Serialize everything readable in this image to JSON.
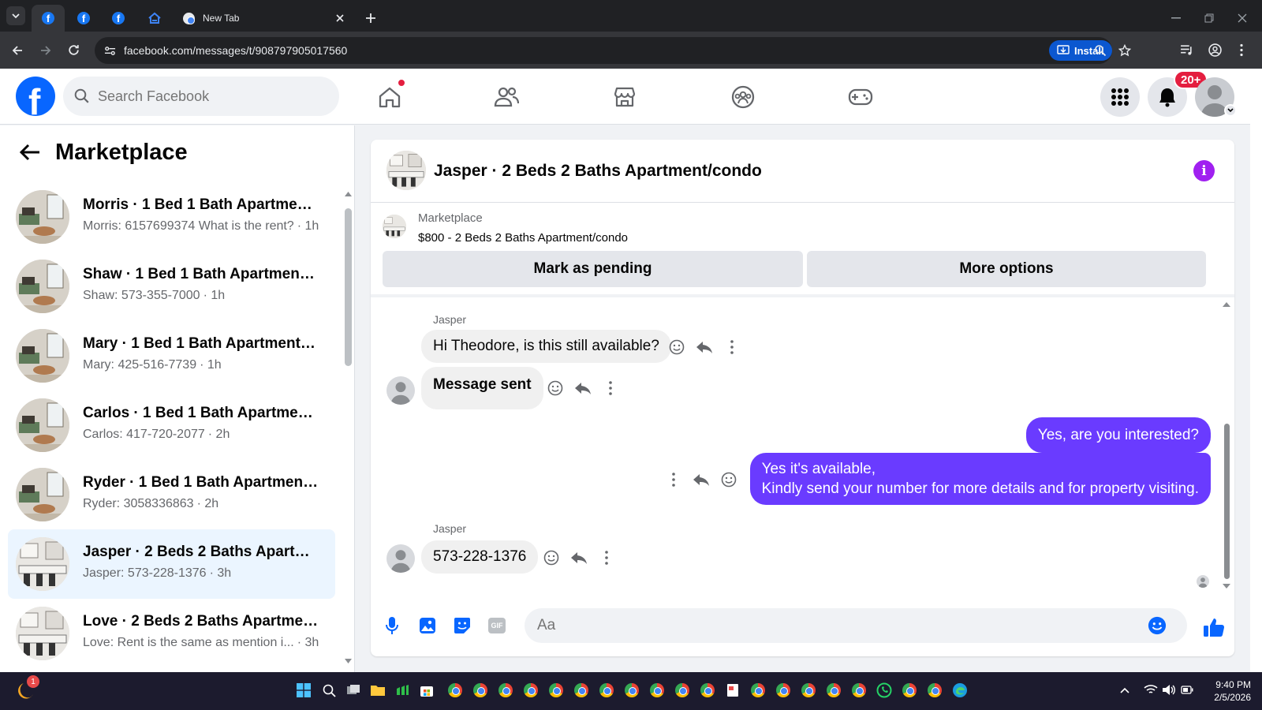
{
  "browser": {
    "tabs": [
      {
        "label": "",
        "icon": "facebook-icon"
      },
      {
        "label": "",
        "icon": "facebook-icon"
      },
      {
        "label": "",
        "icon": "facebook-icon"
      },
      {
        "label": "",
        "icon": "zillow-icon"
      },
      {
        "label": "New Tab",
        "icon": "chrome-icon"
      }
    ],
    "url": "facebook.com/messages/t/908797905017560",
    "install_label": "Install"
  },
  "facebook": {
    "logo_letter": "f",
    "search_placeholder": "Search Facebook",
    "notifications_badge": "20+"
  },
  "sidebar": {
    "title": "Marketplace",
    "conversations": [
      {
        "title": "Morris · 1 Bed 1 Bath Apartment/...",
        "preview": "Morris: 6157699374 What is the rent?",
        "time": "· 1h",
        "selected": false
      },
      {
        "title": "Shaw · 1 Bed 1 Bath Apartment/c...",
        "preview": "Shaw: 573-355-7000",
        "time": "· 1h",
        "selected": false
      },
      {
        "title": "Mary · 1 Bed 1 Bath Apartment/c...",
        "preview": "Mary: 425-516-7739",
        "time": "· 1h",
        "selected": false
      },
      {
        "title": "Carlos · 1 Bed 1 Bath Apartment/...",
        "preview": "Carlos: 417-720-2077",
        "time": "· 2h",
        "selected": false
      },
      {
        "title": "Ryder · 1 Bed 1 Bath Apartment/...",
        "preview": "Ryder: 3058336863",
        "time": "· 2h",
        "selected": false
      },
      {
        "title": "Jasper · 2 Beds 2 Baths Apartme...",
        "preview": "Jasper: 573-228-1376",
        "time": "· 3h",
        "selected": true
      },
      {
        "title": "Love · 2 Beds 2 Baths Apartment...",
        "preview": "Love: Rent is the same as mention i...",
        "time": "· 3h",
        "selected": false
      }
    ]
  },
  "chat": {
    "title": "Jasper · 2 Beds 2 Baths Apartment/condo",
    "marketplace_label": "Marketplace",
    "listing": "$800 - 2 Beds 2 Baths Apartment/condo",
    "mark_pending_label": "Mark as pending",
    "more_options_label": "More options",
    "messages": [
      {
        "sender": "Jasper",
        "text": "Hi Theodore, is this still available?",
        "direction": "in"
      },
      {
        "sender": "",
        "text": "Message sent",
        "direction": "in"
      },
      {
        "sender": "",
        "text": "Yes, are you interested?",
        "direction": "out"
      },
      {
        "sender": "",
        "text": "Yes it's available,",
        "direction": "out"
      },
      {
        "sender": "",
        "text": "Kindly send your number for more details and for property visiting.",
        "direction": "out"
      },
      {
        "sender": "Jasper",
        "text": "573-228-1376",
        "direction": "in"
      }
    ],
    "composer_placeholder": "Aa",
    "gif_label": "GIF"
  },
  "taskbar": {
    "time": "9:40 PM",
    "date": "2/5/2026",
    "start_badge": "1"
  },
  "colors": {
    "facebook_blue": "#0866ff",
    "outgoing_bubble": "#6a3bff",
    "selected_row": "#ebf5ff",
    "badge_red": "#e41e3f"
  }
}
